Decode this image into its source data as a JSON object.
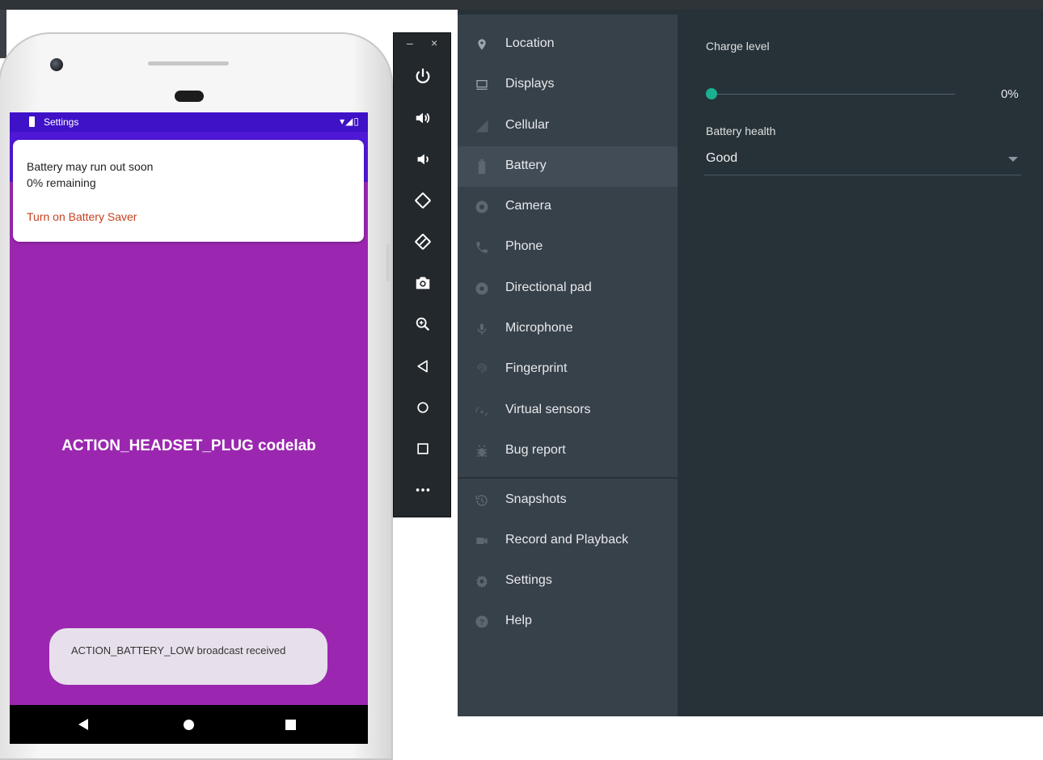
{
  "phone": {
    "status_title": "Settings",
    "notification": {
      "line1": "Battery may run out soon",
      "line2": "0% remaining",
      "action": "Turn on Battery Saver"
    },
    "app_text": "ACTION_HEADSET_PLUG codelab",
    "toast": "ACTION_BATTERY_LOW broadcast received"
  },
  "toolbar": {
    "minimize": "–",
    "close": "×",
    "icons": [
      "power-icon",
      "volume-up-icon",
      "volume-down-icon",
      "rotate-left-icon",
      "rotate-right-icon",
      "screenshot-icon",
      "zoom-icon",
      "back-icon",
      "home-icon",
      "overview-icon",
      "more-icon"
    ]
  },
  "sidebar": {
    "items": [
      {
        "label": "Location",
        "icon": "location-icon"
      },
      {
        "label": "Displays",
        "icon": "display-icon"
      },
      {
        "label": "Cellular",
        "icon": "cellular-icon"
      },
      {
        "label": "Battery",
        "icon": "battery-icon",
        "active": true
      },
      {
        "label": "Camera",
        "icon": "camera-icon"
      },
      {
        "label": "Phone",
        "icon": "phone-icon"
      },
      {
        "label": "Directional pad",
        "icon": "dpad-icon"
      },
      {
        "label": "Microphone",
        "icon": "microphone-icon"
      },
      {
        "label": "Fingerprint",
        "icon": "fingerprint-icon"
      },
      {
        "label": "Virtual sensors",
        "icon": "virtual-sensors-icon"
      },
      {
        "label": "Bug report",
        "icon": "bug-icon"
      },
      {
        "label": "Snapshots",
        "icon": "snapshots-icon"
      },
      {
        "label": "Record and Playback",
        "icon": "record-icon"
      },
      {
        "label": "Settings",
        "icon": "settings-icon"
      },
      {
        "label": "Help",
        "icon": "help-icon"
      }
    ]
  },
  "battery": {
    "charge_label": "Charge level",
    "charge_value": "0%",
    "charge_fraction": 0,
    "health_label": "Battery health",
    "health_value": "Good"
  },
  "colors": {
    "accent": "#19b08f",
    "status_bar": "#3f12c7",
    "app_bg": "#9b27b0",
    "link": "#c6401d",
    "sidebar_bg": "#37414a",
    "panel_bg": "#263238"
  }
}
